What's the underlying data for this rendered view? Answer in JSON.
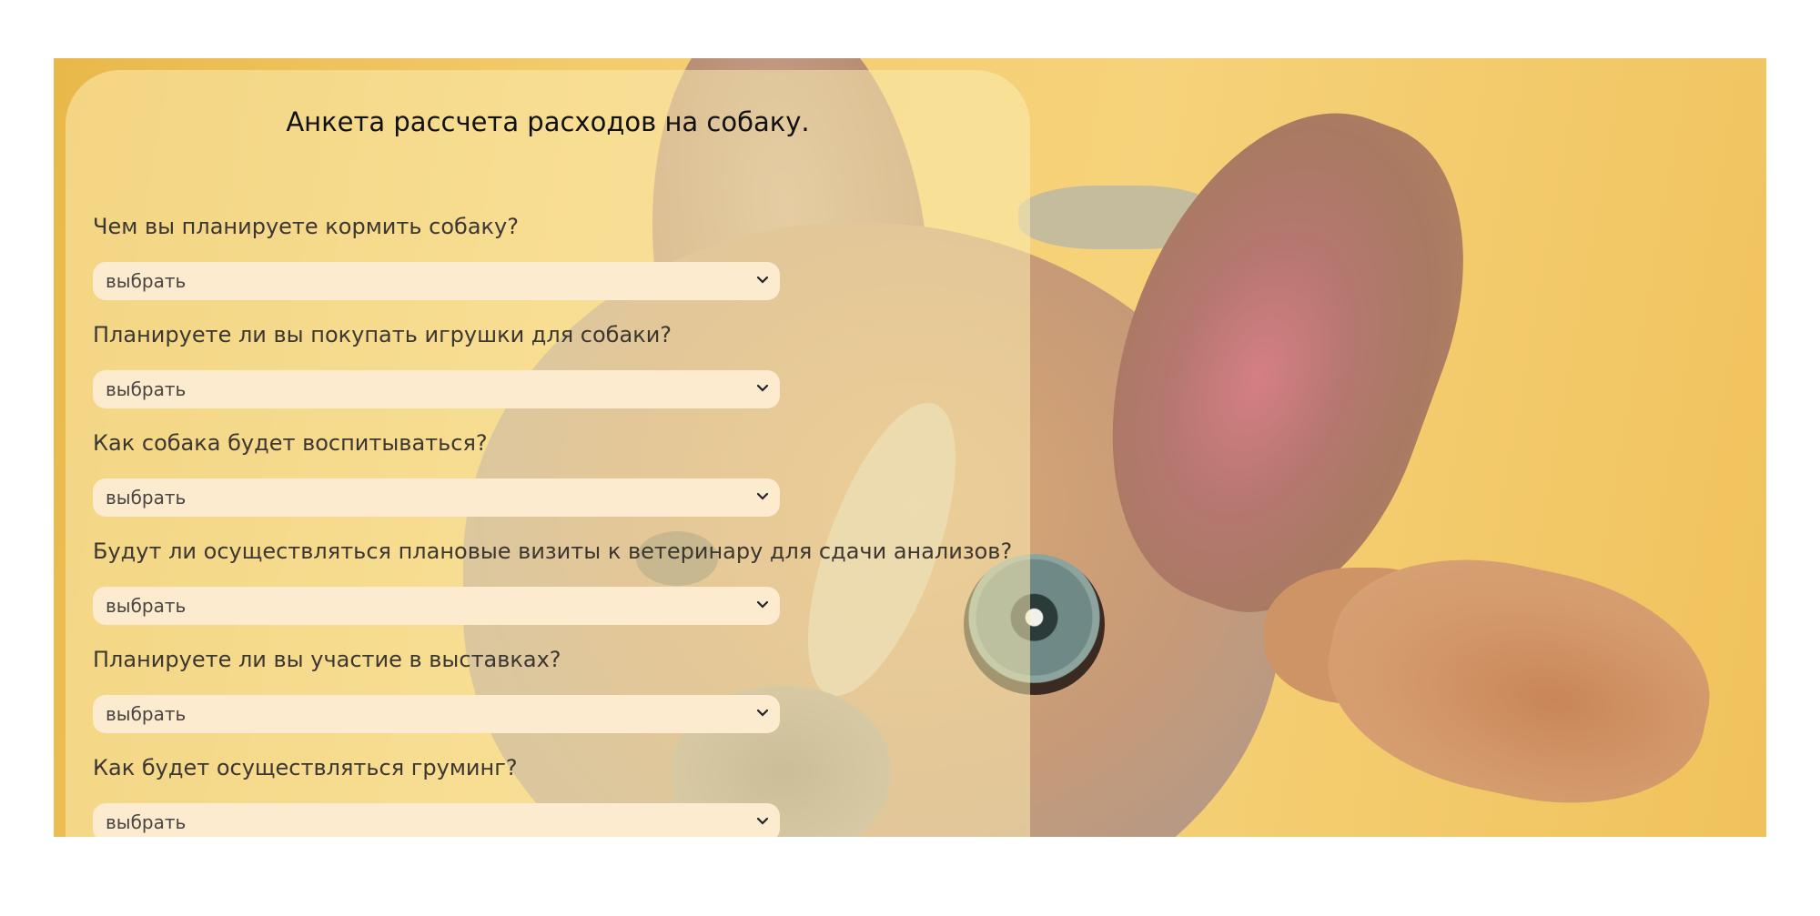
{
  "form": {
    "title": "Анкета рассчета расходов на собаку.",
    "select_placeholder": "выбрать",
    "questions": [
      {
        "label": "Чем вы планируете кормить собаку?",
        "value": "выбрать"
      },
      {
        "label": "Планируете ли вы покупать игрушки для собаки?",
        "value": "выбрать"
      },
      {
        "label": "Как собака будет воспитываться?",
        "value": "выбрать"
      },
      {
        "label": "Будут ли осуществляться плановые визиты к ветеринару для сдачи анализов?",
        "value": "выбрать"
      },
      {
        "label": "Планируете ли вы участие в выставках?",
        "value": "выбрать"
      },
      {
        "label": "Как будет осуществляться груминг?",
        "value": "выбрать"
      }
    ]
  },
  "hero": {
    "background_color": "#f3cc6e",
    "image": "dog-photo"
  },
  "icons": {
    "select_arrow": "chevron-down-icon"
  }
}
